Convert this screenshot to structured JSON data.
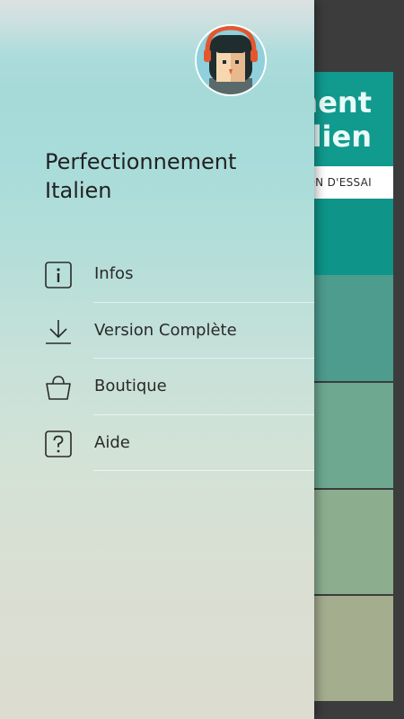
{
  "background_app": {
    "header_line1": "ment",
    "header_line2": "alien",
    "trial_label": "ON D'ESSAI",
    "colors": {
      "header": "#119a8e",
      "bands": [
        "#0e9488",
        "#4d9c8e",
        "#6ea891",
        "#8cae8f",
        "#a5ad8f"
      ]
    }
  },
  "drawer": {
    "title": "Perfectionnement Italien",
    "avatar": {
      "icon": "character-avatar-icon"
    },
    "menu": [
      {
        "label": "Infos",
        "icon": "info-icon"
      },
      {
        "label": "Version Complète",
        "icon": "download-icon"
      },
      {
        "label": "Boutique",
        "icon": "shopping-basket-icon"
      },
      {
        "label": "Aide",
        "icon": "help-icon"
      }
    ]
  }
}
